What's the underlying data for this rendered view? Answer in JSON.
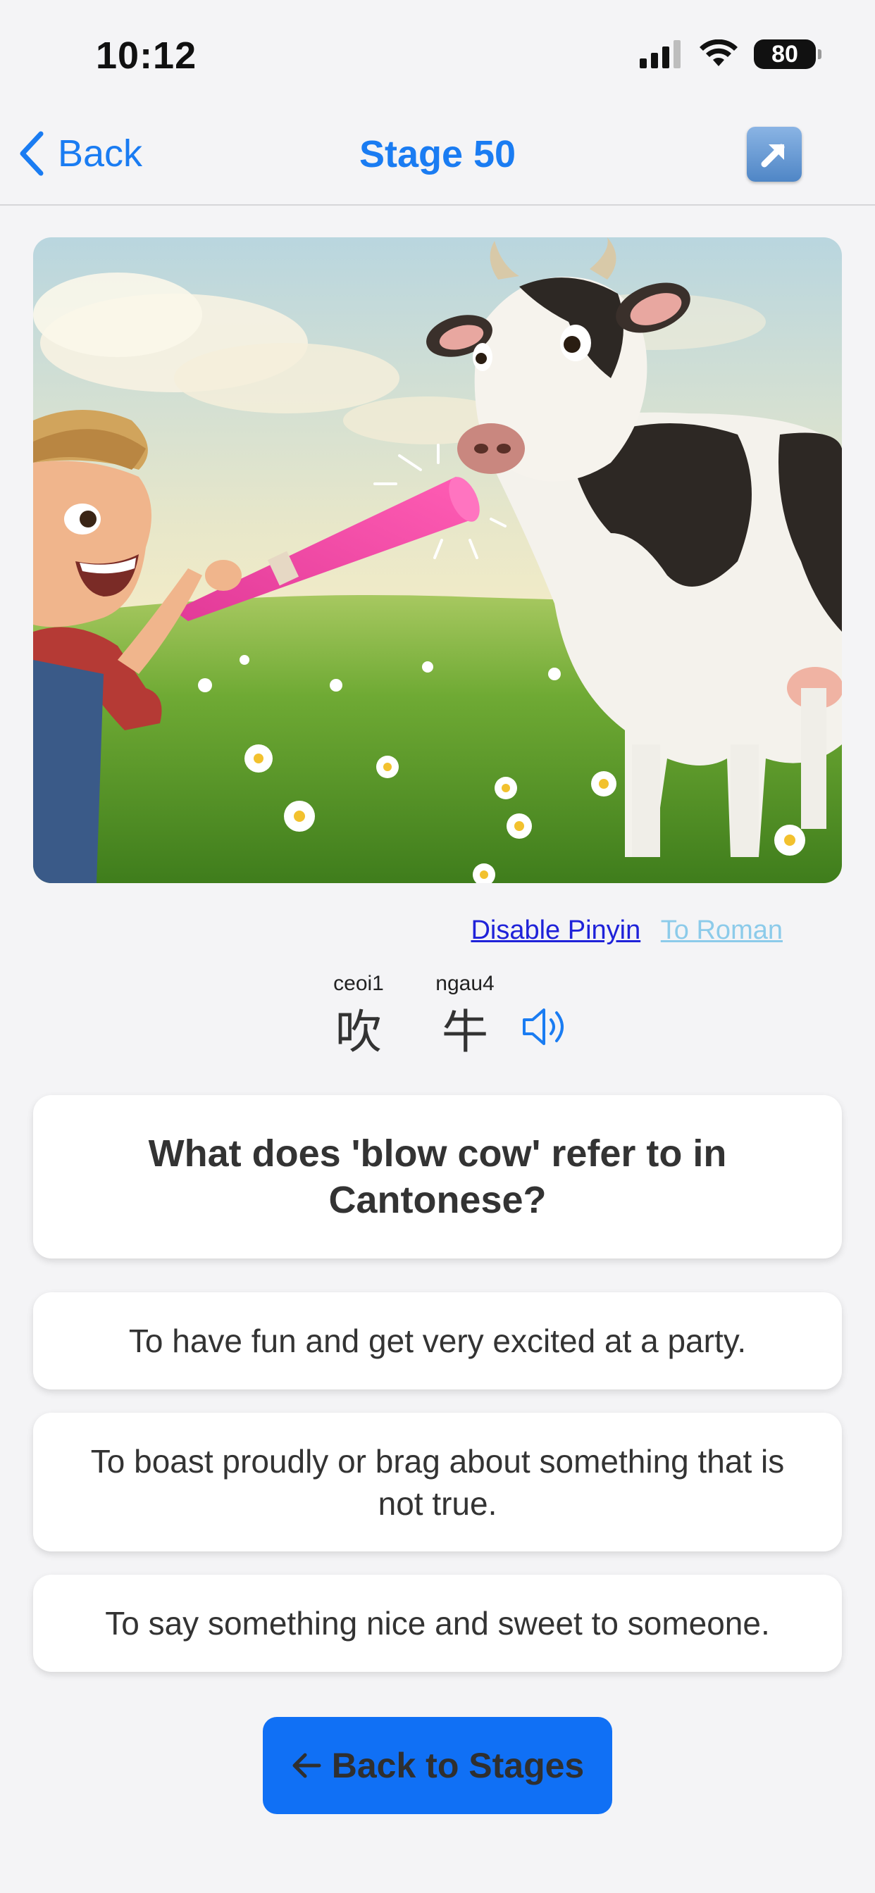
{
  "status_bar": {
    "time": "10:12",
    "battery": "80"
  },
  "nav": {
    "back_label": "Back",
    "title": "Stage 50"
  },
  "hero": {
    "description_icon": "boy-blowing-horn-at-cow-image"
  },
  "toggles": {
    "pinyin": "Disable Pinyin",
    "roman": "To Roman"
  },
  "phrase": {
    "chars": [
      {
        "romanization": "ceoi1",
        "hanzi": "吹"
      },
      {
        "romanization": "ngau4",
        "hanzi": "牛"
      }
    ]
  },
  "question": "What does 'blow cow' refer to in Cantonese?",
  "answers": [
    "To have fun and get very excited at a party.",
    "To boast proudly or brag about something that is not true.",
    "To say something nice and sweet to someone."
  ],
  "footer": {
    "back_to_stages": "Back to Stages"
  },
  "colors": {
    "accent": "#1a7cf2",
    "button": "#1070f5",
    "pinyin_link": "#1f22d9",
    "roman_link": "#8ccbea"
  }
}
